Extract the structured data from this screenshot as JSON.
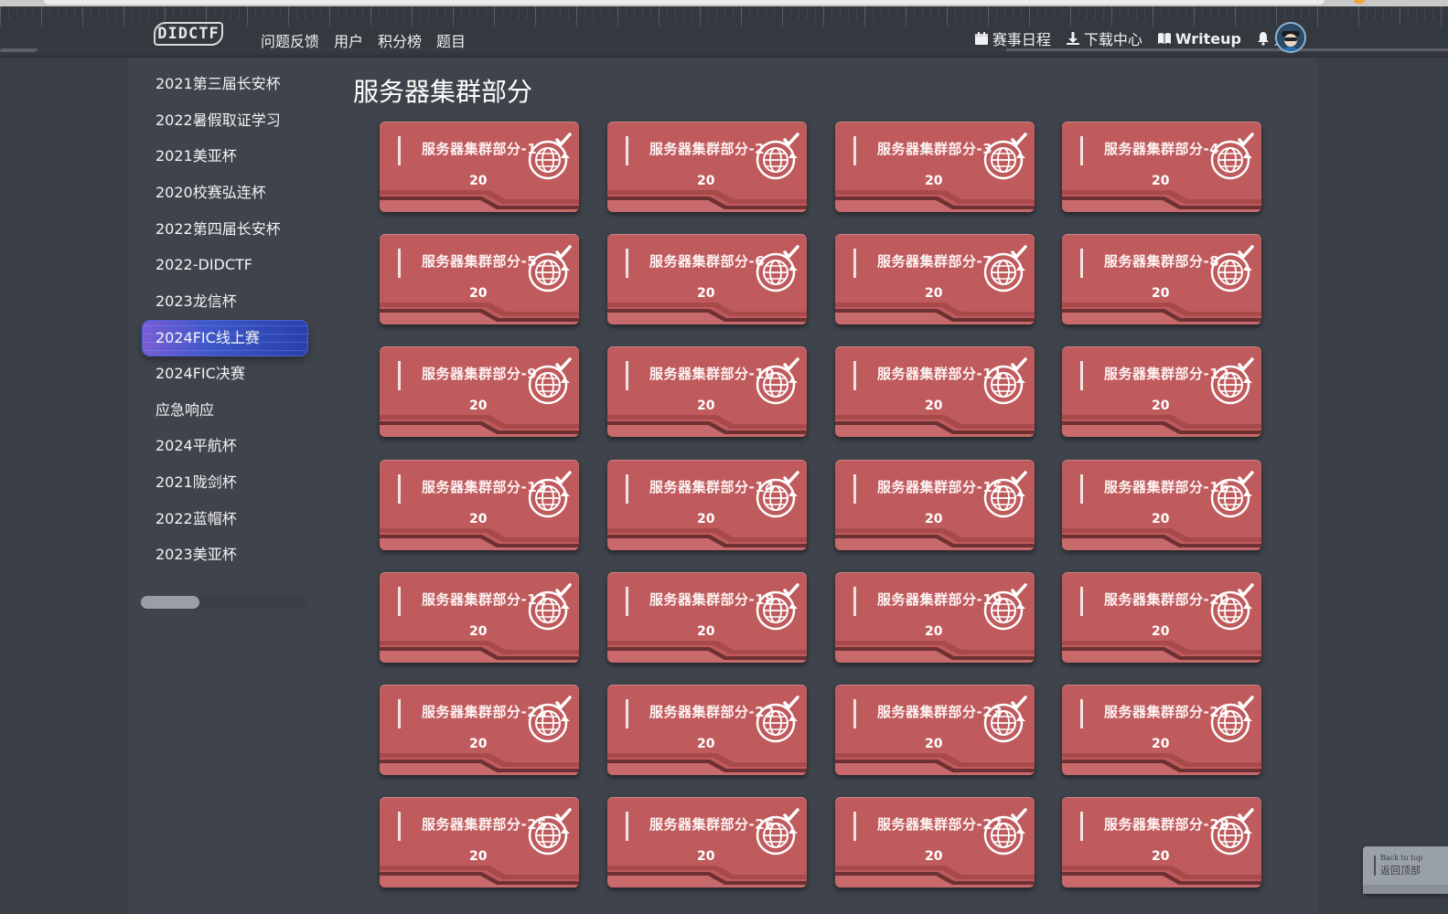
{
  "nav": {
    "logo": "DIDCTF",
    "left_links": [
      "问题反馈",
      "用户",
      "积分榜",
      "题目"
    ],
    "right_links": [
      {
        "label": "赛事日程",
        "icon": "calendar-icon"
      },
      {
        "label": "下载中心",
        "icon": "download-icon"
      },
      {
        "label": "Writeup",
        "icon": "book-icon"
      },
      {
        "label": "通知",
        "icon": "bell-icon"
      }
    ]
  },
  "sidebar": {
    "items": [
      "2021第三届长安杯",
      "2022暑假取证学习",
      "2021美亚杯",
      "2020校赛弘连杯",
      "2022第四届长安杯",
      "2022-DIDCTF",
      "2023龙信杯",
      "2024FIC线上赛",
      "2024FIC决赛",
      "应急响应",
      "2024平航杯",
      "2021陇剑杯",
      "2022蓝帽杯",
      "2023美亚杯"
    ],
    "active_index": 7
  },
  "main": {
    "title": "服务器集群部分",
    "cards": [
      {
        "name": "服务器集群部分-1",
        "score": "20"
      },
      {
        "name": "服务器集群部分-2",
        "score": "20"
      },
      {
        "name": "服务器集群部分-3",
        "score": "20"
      },
      {
        "name": "服务器集群部分-4",
        "score": "20"
      },
      {
        "name": "服务器集群部分-5",
        "score": "20"
      },
      {
        "name": "服务器集群部分-6",
        "score": "20"
      },
      {
        "name": "服务器集群部分-7",
        "score": "20"
      },
      {
        "name": "服务器集群部分-8",
        "score": "20"
      },
      {
        "name": "服务器集群部分-9",
        "score": "20"
      },
      {
        "name": "服务器集群部分-10",
        "score": "20"
      },
      {
        "name": "服务器集群部分-11",
        "score": "20"
      },
      {
        "name": "服务器集群部分-12",
        "score": "20"
      },
      {
        "name": "服务器集群部分-13",
        "score": "20"
      },
      {
        "name": "服务器集群部分-14",
        "score": "20"
      },
      {
        "name": "服务器集群部分-15",
        "score": "20"
      },
      {
        "name": "服务器集群部分-16",
        "score": "20"
      },
      {
        "name": "服务器集群部分-17",
        "score": "20"
      },
      {
        "name": "服务器集群部分-18",
        "score": "20"
      },
      {
        "name": "服务器集群部分-19",
        "score": "20"
      },
      {
        "name": "服务器集群部分-20",
        "score": "20"
      },
      {
        "name": "服务器集群部分-21",
        "score": "20"
      },
      {
        "name": "服务器集群部分-22",
        "score": "20"
      },
      {
        "name": "服务器集群部分-23",
        "score": "20"
      },
      {
        "name": "服务器集群部分-24",
        "score": "20"
      },
      {
        "name": "服务器集群部分-25",
        "score": "20"
      },
      {
        "name": "服务器集群部分-26",
        "score": "20"
      },
      {
        "name": "服务器集群部分-27",
        "score": "20"
      },
      {
        "name": "服务器集群部分-28",
        "score": "20"
      }
    ]
  },
  "back_to_top": {
    "en": "Back to top",
    "zh": "返回顶部"
  },
  "colors": {
    "card": "#c05b5d",
    "panel": "#3f434b",
    "background": "#3a3e45",
    "active_item": "#3f58c9"
  }
}
